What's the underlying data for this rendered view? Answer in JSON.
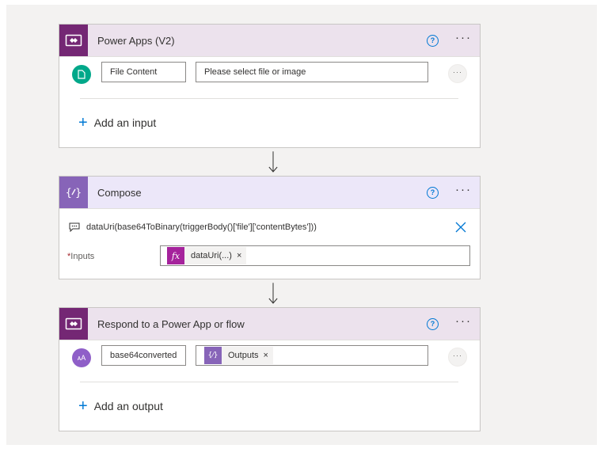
{
  "steps": {
    "powerapps": {
      "title": "Power Apps (V2)",
      "input_label": "File Content",
      "input_placeholder": "Please select file or image",
      "add_input": "Add an input",
      "ellipsis": "···",
      "more": "···",
      "help": "?",
      "accent": "#742774",
      "header_bg": "#ece2ed"
    },
    "compose": {
      "title": "Compose",
      "expression": "dataUri(base64ToBinary(triggerBody()['file']['contentBytes']))",
      "inputs_label": "Inputs",
      "required_mark": "*",
      "token_label": "dataUri(...)",
      "token_icon": "fx",
      "token_close": "×",
      "more": "···",
      "help": "?",
      "accent": "#8764b8",
      "header_bg": "#ece7f9"
    },
    "respond": {
      "title": "Respond to a Power App or flow",
      "output_name": "base64converted",
      "token_label": "Outputs",
      "token_icon": "{⁄}",
      "token_close": "×",
      "add_output": "Add an output",
      "ellipsis": "···",
      "more": "···",
      "help": "?",
      "avatar_text": "ᴀA",
      "accent": "#742774",
      "header_bg": "#ece2ed"
    }
  },
  "icons": {
    "powerapps": "power-apps-icon",
    "compose": "compose-icon",
    "file": "file-icon",
    "text": "text-type-icon",
    "arrow": "arrow-down-icon",
    "close": "close-icon",
    "expression": "expression-icon"
  },
  "colors": {
    "primary": "#0078d4",
    "file_circle": "#00a88a",
    "text_circle": "#8f5fc8",
    "fx_token": "#a5239c",
    "compose_token": "#8764b8"
  }
}
